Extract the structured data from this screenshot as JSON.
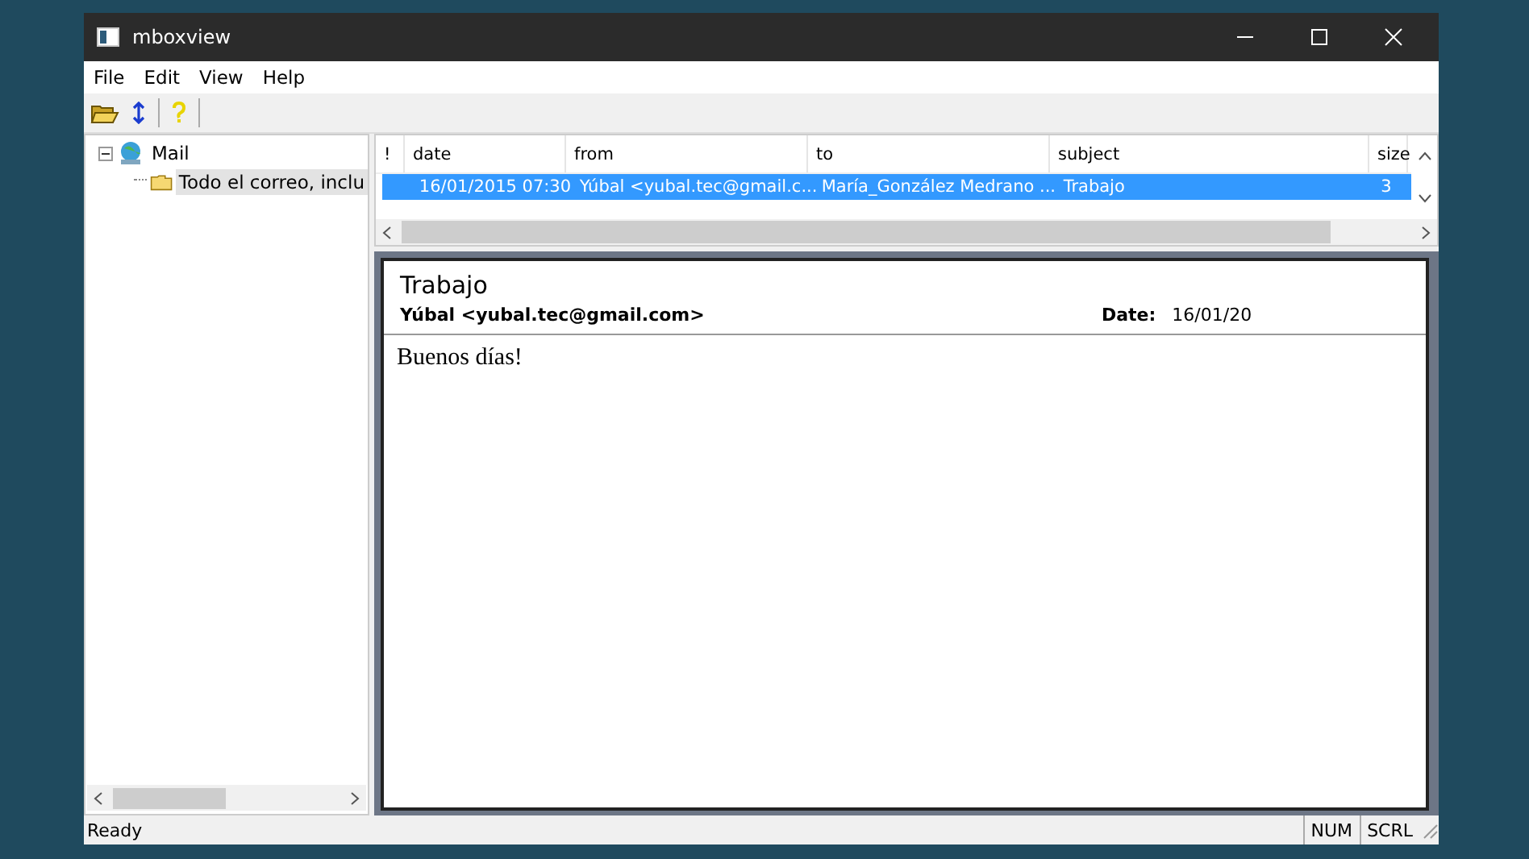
{
  "window": {
    "title": "mboxview"
  },
  "menu": [
    "File",
    "Edit",
    "View",
    "Help"
  ],
  "tree": {
    "label": "Mail",
    "expanded": true,
    "children": [
      {
        "label": "Todo el correo, inclu",
        "selected": true
      }
    ]
  },
  "table": {
    "columns": [
      "!",
      "date",
      "from",
      "to",
      "subject",
      "size"
    ],
    "rows": [
      {
        "selected": true,
        "cells": [
          "",
          "16/01/2015 07:30",
          "Yúbal <yubal.tec@gmail.c...",
          "María_González Medrano ...",
          "Trabajo",
          "3"
        ]
      }
    ]
  },
  "message": {
    "subject": "Trabajo",
    "from": "Yúbal <yubal.tec@gmail.com>",
    "date_label": "Date:",
    "date": "16/01/20",
    "body": [
      "Buenos días!"
    ]
  },
  "status_bar": {
    "text": "Ready",
    "indicators": [
      "NUM",
      "SCRL"
    ]
  }
}
